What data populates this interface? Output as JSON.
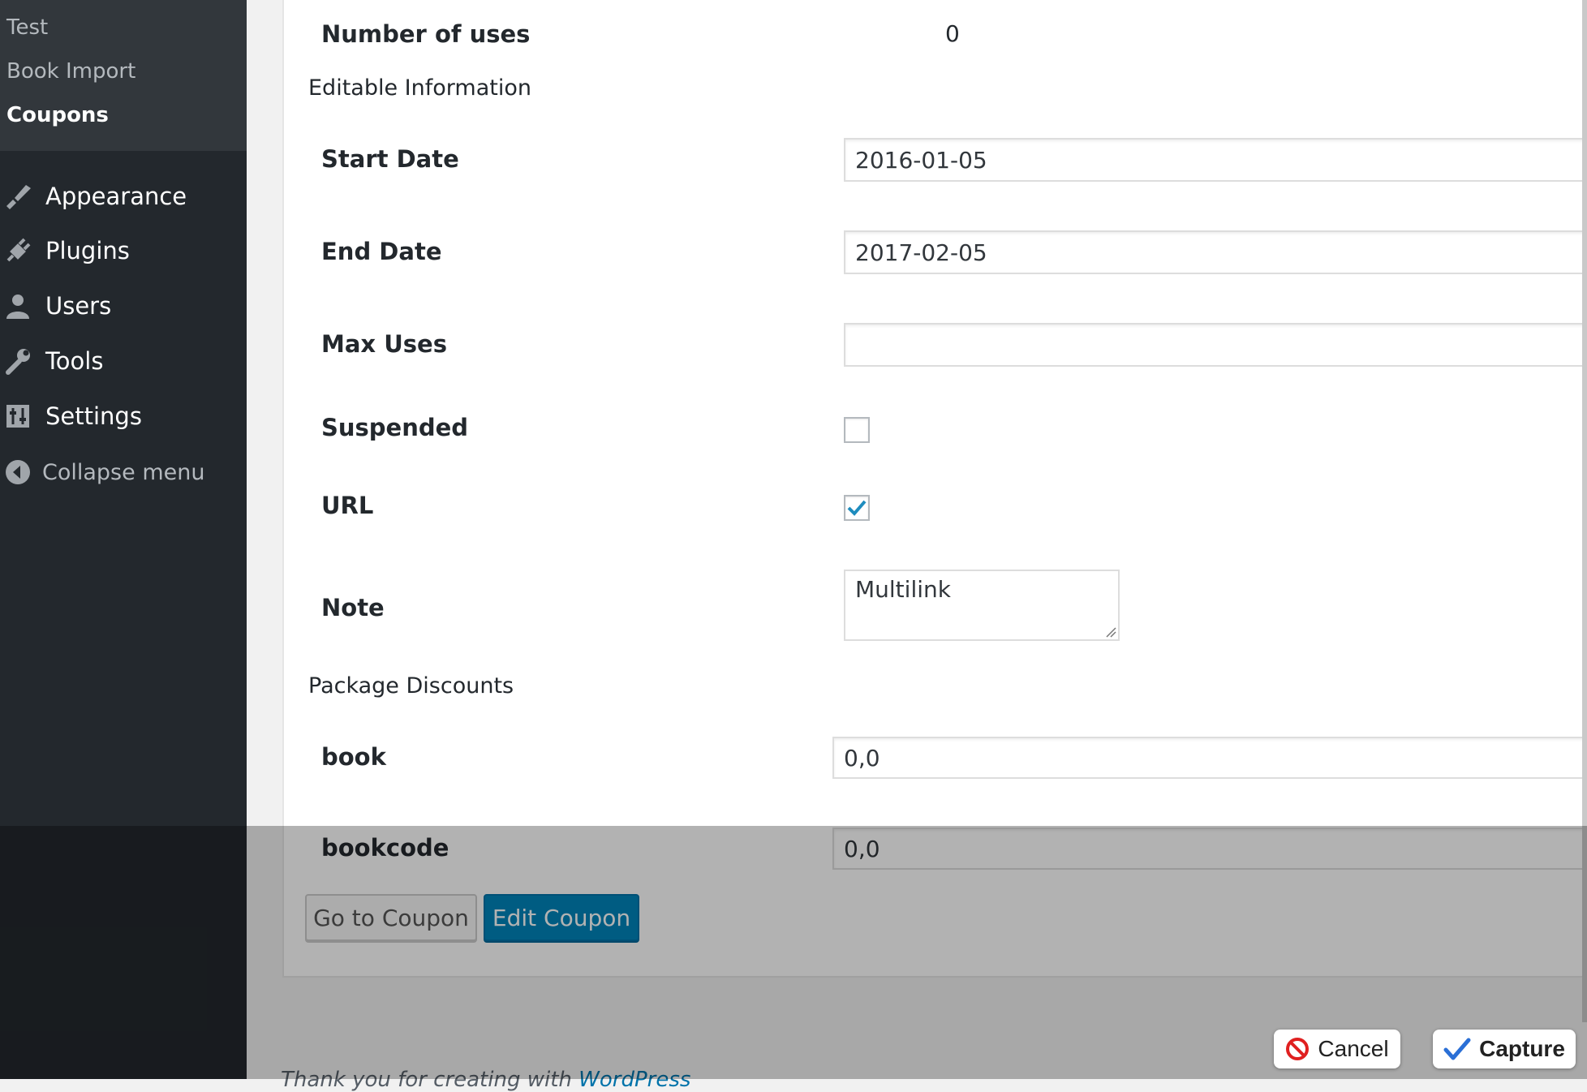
{
  "sidebar": {
    "submenu": [
      {
        "label": "Test"
      },
      {
        "label": "Book Import"
      },
      {
        "label": "Coupons",
        "current": true
      }
    ],
    "menu": [
      {
        "label": "Appearance",
        "icon": "paintbrush-icon"
      },
      {
        "label": "Plugins",
        "icon": "plug-icon"
      },
      {
        "label": "Users",
        "icon": "user-icon"
      },
      {
        "label": "Tools",
        "icon": "wrench-icon"
      },
      {
        "label": "Settings",
        "icon": "sliders-icon"
      }
    ],
    "collapse_label": "Collapse menu"
  },
  "coupon": {
    "number_of_uses_label": "Number of uses",
    "number_of_uses_value": "0",
    "editable_section_title": "Editable Information",
    "start_date_label": "Start Date",
    "start_date_value": "2016-01-05",
    "end_date_label": "End Date",
    "end_date_value": "2017-02-05",
    "max_uses_label": "Max Uses",
    "max_uses_value": "",
    "suspended_label": "Suspended",
    "suspended_checked": false,
    "url_label": "URL",
    "url_checked": true,
    "note_label": "Note",
    "note_value": "Multilink",
    "package_section_title": "Package Discounts",
    "packages": [
      {
        "label": "book",
        "value": "0,0"
      },
      {
        "label": "bookcode",
        "value": "0,0"
      }
    ]
  },
  "buttons": {
    "go_to_coupon": "Go to Coupon",
    "edit_coupon": "Edit Coupon"
  },
  "footer": {
    "text_prefix": "Thank you for creating with",
    "link": "WordPress"
  },
  "capture_bar": {
    "cancel_label": "Cancel",
    "capture_label": "Capture"
  },
  "colors": {
    "sidebar_bg": "#23282d",
    "submenu_bg": "#32373c",
    "primary_button": "#0085ba",
    "checkmark": "#1e8cbe"
  }
}
